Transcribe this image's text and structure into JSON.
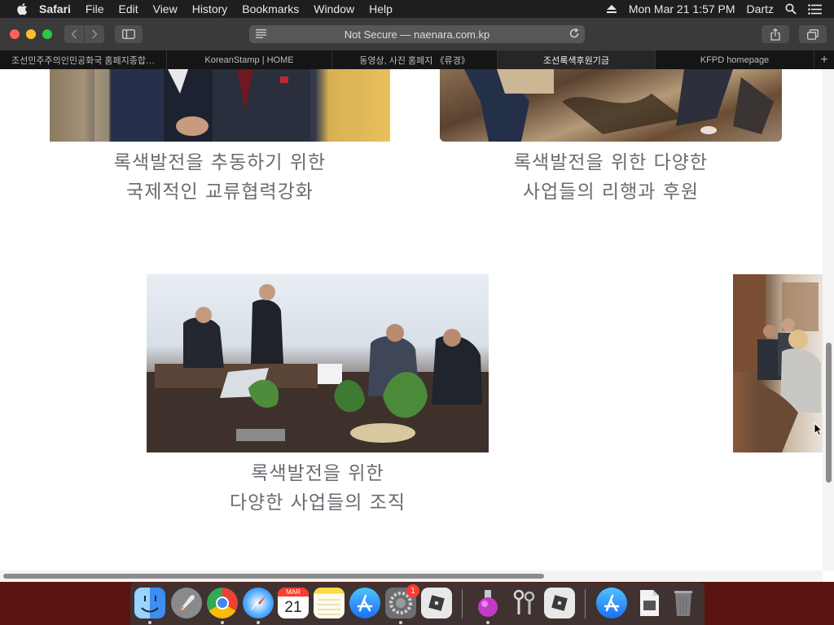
{
  "menubar": {
    "app_name": "Safari",
    "items": [
      "File",
      "Edit",
      "View",
      "History",
      "Bookmarks",
      "Window",
      "Help"
    ],
    "datetime": "Mon Mar 21  1:57 PM",
    "user": "Dartz"
  },
  "toolbar": {
    "url_text": "Not Secure — naenara.com.kp"
  },
  "tabs": [
    {
      "label": "조선민주주의인민공화국 홈페지종합…",
      "active": false
    },
    {
      "label": "KoreanStamp | HOME",
      "active": false
    },
    {
      "label": "동영상, 사진 홈페지 《류경》",
      "active": false
    },
    {
      "label": "조선록색후원기금",
      "active": true
    },
    {
      "label": "KFPD homepage",
      "active": false
    }
  ],
  "content": {
    "captions": [
      {
        "line1": "록색발전을 추동하기 위한",
        "line2": "국제적인 교류협력강화"
      },
      {
        "line1": "록색발전을 위한 다양한",
        "line2": "사업들의 리행과 후원"
      },
      {
        "line1": "록색발전을 위한",
        "line2": "다양한 사업들의 조직"
      }
    ]
  },
  "dock": {
    "calendar_month": "MAR",
    "calendar_day": "21",
    "settings_badge": "1",
    "items": [
      "finder-icon",
      "launchpad-icon",
      "chrome-icon",
      "safari-icon",
      "calendar-icon",
      "notes-icon",
      "app-store-icon",
      "system-preferences-icon",
      "roblox-icon",
      "roblox-studio-icon",
      "keychain-access-icon",
      "roblox-app-icon",
      "app-store-downloads-icon",
      "preview-file-icon",
      "trash-icon"
    ]
  },
  "colors": {
    "menubar_bg": "#1e1e1e",
    "toolbar_bg": "#3a3a3a",
    "caption_text": "#6a6a72",
    "close": "#ff5f57",
    "minimize": "#febc2e",
    "zoom": "#28c840"
  }
}
